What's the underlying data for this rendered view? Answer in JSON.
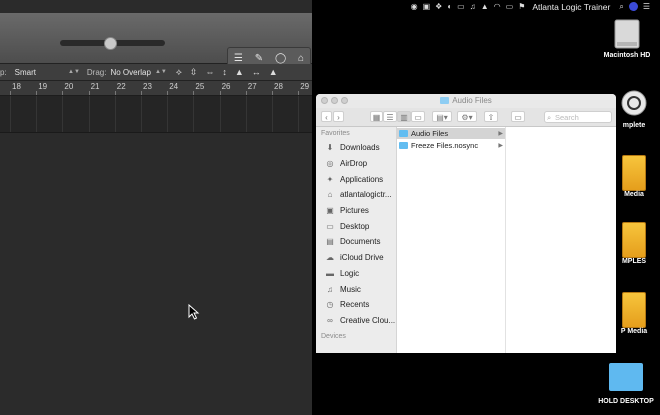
{
  "menubar": {
    "app_title": "Atlanta Logic Trainer",
    "icons": [
      "screen-record-icon",
      "screen-icon",
      "dropbox-icon",
      "circle-logo-icon",
      "display-icon",
      "audio-icon",
      "airplay-icon",
      "wifi-icon",
      "battery-icon",
      "flag-icon",
      "search-icon",
      "user-badge-icon",
      "list-icon"
    ]
  },
  "logic": {
    "edit_bar": {
      "snap_label": "p:",
      "snap_value": "Smart",
      "drag_label": "Drag:",
      "drag_value": "No Overlap"
    },
    "ruler_numbers": [
      "18",
      "19",
      "20",
      "21",
      "22",
      "23",
      "24",
      "25",
      "26",
      "27",
      "28",
      "29"
    ]
  },
  "desktop": {
    "items": [
      {
        "label": "Macintosh HD"
      },
      {
        "label": "mplete"
      },
      {
        "label": "Media"
      },
      {
        "label": "MPLES"
      },
      {
        "label": "P Media"
      },
      {
        "label": "HOLD DESKTOP"
      }
    ]
  },
  "finder": {
    "title": "Audio Files",
    "search_placeholder": "Search",
    "favorites_header": "Favorites",
    "devices_header": "Devices",
    "sidebar_items": [
      {
        "label": "Downloads",
        "icon": "download-icon"
      },
      {
        "label": "AirDrop",
        "icon": "airdrop-icon"
      },
      {
        "label": "Applications",
        "icon": "applications-icon"
      },
      {
        "label": "atlantalogictr...",
        "icon": "home-icon"
      },
      {
        "label": "Pictures",
        "icon": "pictures-icon"
      },
      {
        "label": "Desktop",
        "icon": "desktop-icon"
      },
      {
        "label": "Documents",
        "icon": "documents-icon"
      },
      {
        "label": "iCloud Drive",
        "icon": "cloud-icon"
      },
      {
        "label": "Logic",
        "icon": "folder-icon"
      },
      {
        "label": "Music",
        "icon": "music-icon"
      },
      {
        "label": "Recents",
        "icon": "recents-icon"
      },
      {
        "label": "Creative Clou...",
        "icon": "creative-cloud-icon"
      }
    ],
    "column_items": [
      {
        "label": "Audio Files",
        "selected": true
      },
      {
        "label": "Freeze Files.nosync",
        "selected": false
      }
    ]
  }
}
